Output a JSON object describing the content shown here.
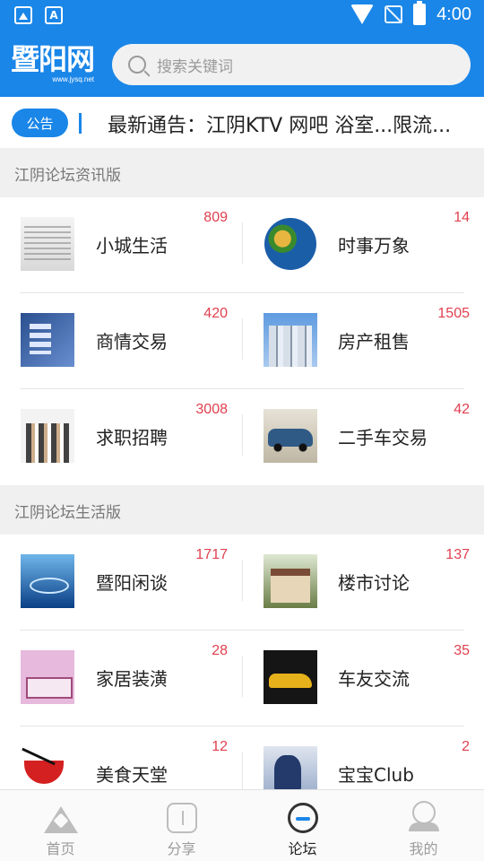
{
  "status_bar": {
    "time": "4:00"
  },
  "header": {
    "logo_cn": "暨阳网",
    "logo_url": "www.jysq.net",
    "search_placeholder": "搜索关键词"
  },
  "notice": {
    "tag": "公告",
    "text": "最新通告：江阴KTV 网吧 浴室...限流..."
  },
  "sections": [
    {
      "title": "江阴论坛资讯版",
      "items": [
        {
          "label": "小城生活",
          "count": "809"
        },
        {
          "label": "时事万象",
          "count": "14"
        },
        {
          "label": "商情交易",
          "count": "420"
        },
        {
          "label": "房产租售",
          "count": "1505"
        },
        {
          "label": "求职招聘",
          "count": "3008"
        },
        {
          "label": "二手车交易",
          "count": "42"
        }
      ]
    },
    {
      "title": "江阴论坛生活版",
      "items": [
        {
          "label": "暨阳闲谈",
          "count": "1717"
        },
        {
          "label": "楼市讨论",
          "count": "137"
        },
        {
          "label": "家居装潢",
          "count": "28"
        },
        {
          "label": "车友交流",
          "count": "35"
        },
        {
          "label": "美食天堂",
          "count": "12"
        },
        {
          "label": "宝宝Club",
          "count": "2"
        }
      ]
    }
  ],
  "bottom_nav": [
    {
      "label": "首页",
      "icon": "home-icon"
    },
    {
      "label": "分享",
      "icon": "share-icon"
    },
    {
      "label": "论坛",
      "icon": "forum-icon",
      "active": true
    },
    {
      "label": "我的",
      "icon": "profile-icon"
    }
  ],
  "colors": {
    "accent": "#1a86e8",
    "count": "#e0404f"
  }
}
